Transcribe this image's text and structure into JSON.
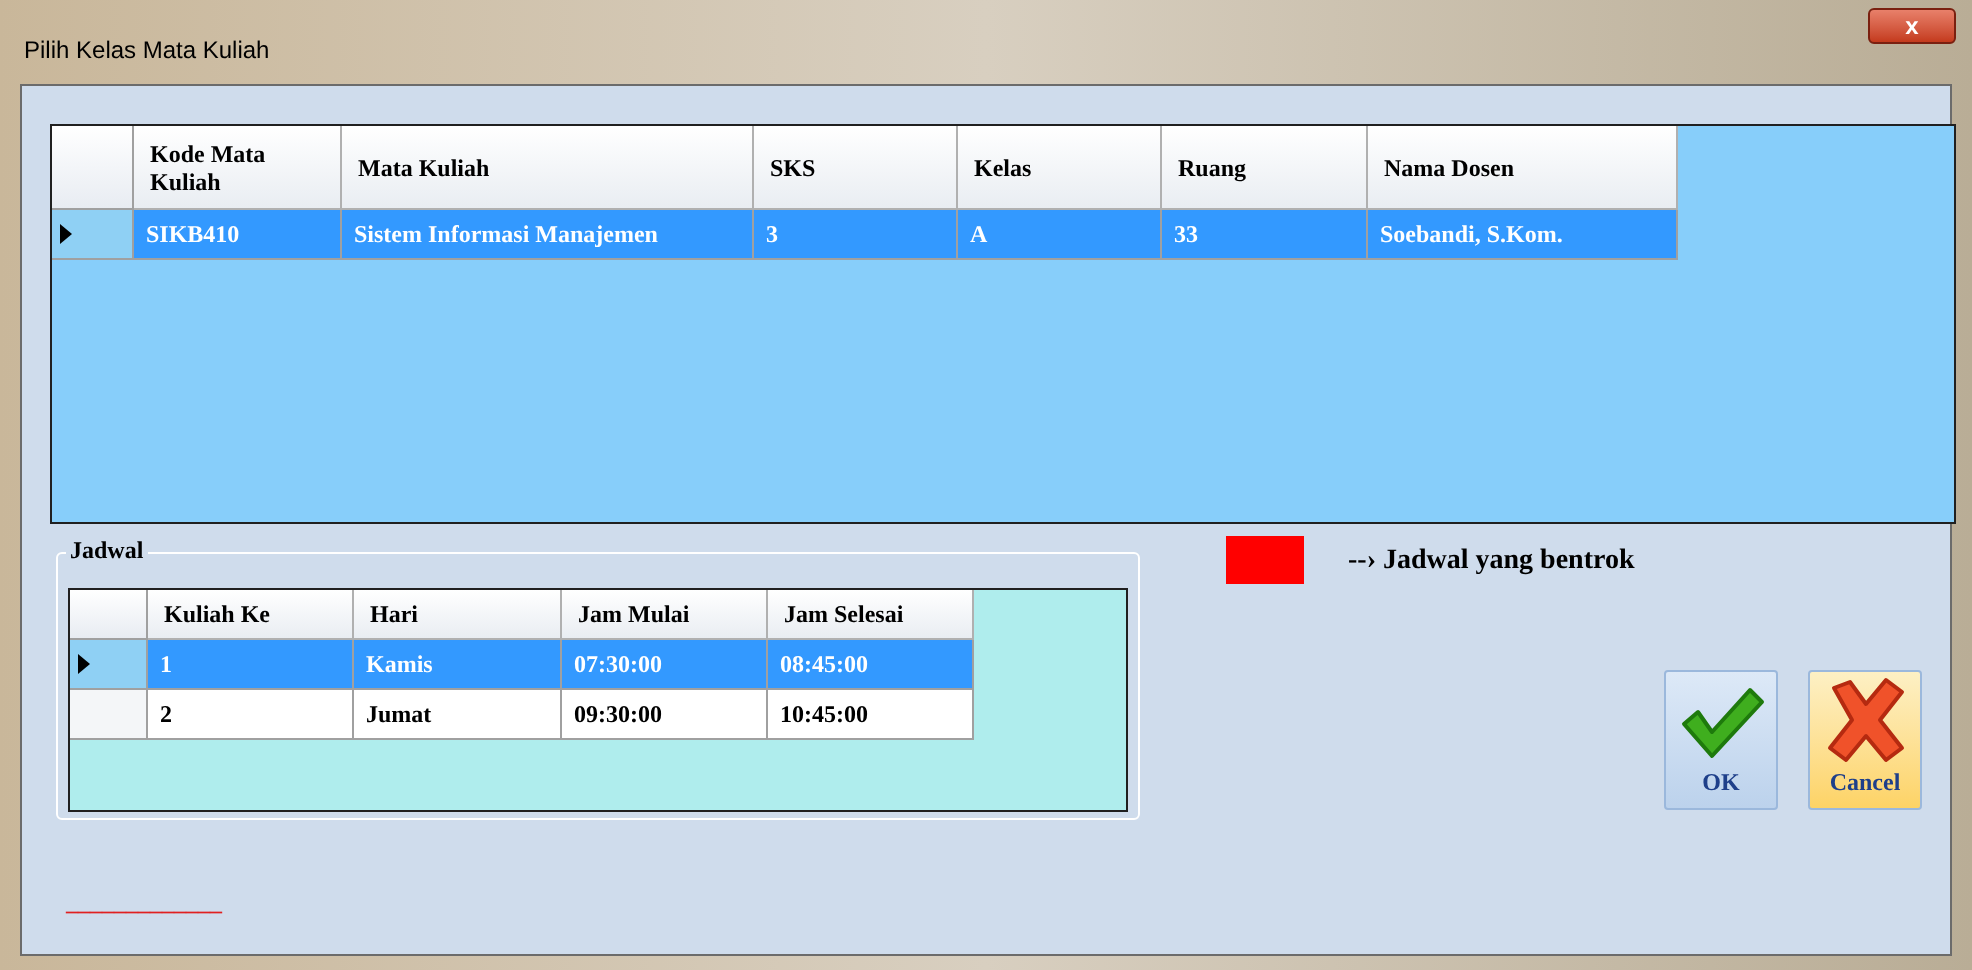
{
  "window": {
    "title": "Pilih Kelas Mata Kuliah",
    "close": "x"
  },
  "courses": {
    "columns": [
      "Kode Mata Kuliah",
      "Mata Kuliah",
      "SKS",
      "Kelas",
      "Ruang",
      "Nama Dosen"
    ],
    "rows": [
      {
        "selected": true,
        "cells": [
          "SIKB410",
          "Sistem Informasi Manajemen",
          "3",
          "A",
          "33",
          "Soebandi, S.Kom."
        ]
      }
    ]
  },
  "jadwal": {
    "title": "Jadwal",
    "columns": [
      "Kuliah Ke",
      "Hari",
      "Jam Mulai",
      "Jam Selesai"
    ],
    "rows": [
      {
        "selected": true,
        "cells": [
          "1",
          "Kamis",
          "07:30:00",
          "08:45:00"
        ]
      },
      {
        "selected": false,
        "cells": [
          "2",
          "Jumat",
          "09:30:00",
          "10:45:00"
        ]
      }
    ]
  },
  "legend": {
    "color": "#ff0000",
    "text": "--› Jadwal yang bentrok"
  },
  "buttons": [
    {
      "kind": "ok",
      "label": "OK"
    },
    {
      "kind": "cancel",
      "label": "Cancel"
    }
  ],
  "status": "_____________"
}
